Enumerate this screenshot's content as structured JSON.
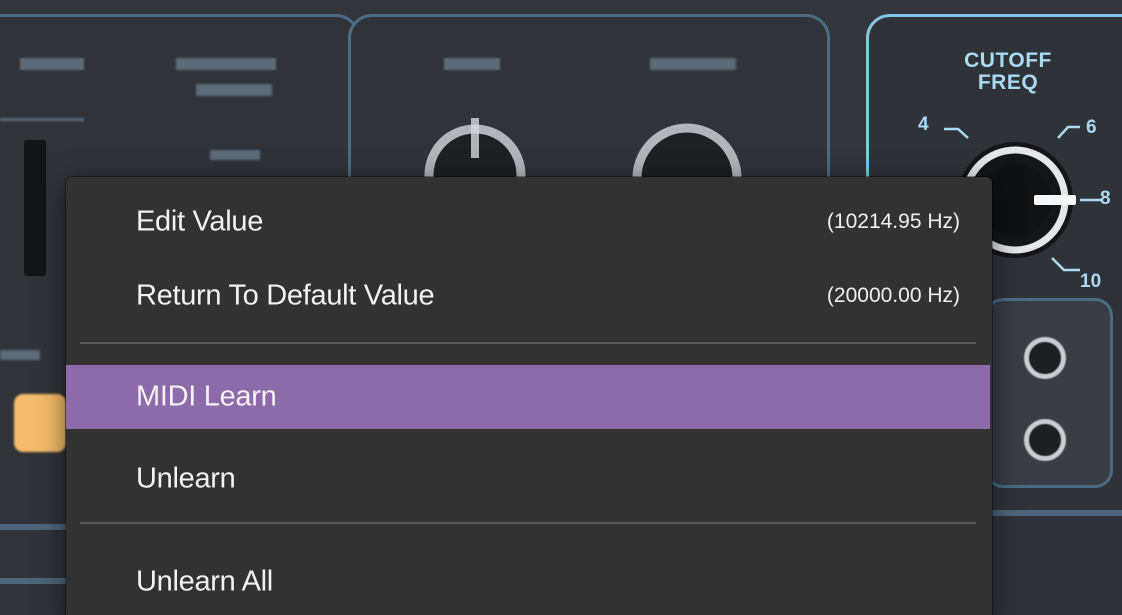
{
  "menu": {
    "items": [
      {
        "label": "Edit Value",
        "value": "(10214.95 Hz)",
        "highlighted": false
      },
      {
        "label": "Return To Default Value",
        "value": "(20000.00 Hz)",
        "highlighted": false
      },
      {
        "label": "MIDI Learn",
        "value": "",
        "highlighted": true
      },
      {
        "label": "Unlearn",
        "value": "",
        "highlighted": false
      },
      {
        "label": "Unlearn All",
        "value": "",
        "highlighted": false
      }
    ],
    "highlight_color": "#8d6aaa"
  },
  "filter": {
    "title_line1": "CUTOFF",
    "title_line2": "FREQ",
    "ticks": [
      "4",
      "6",
      "8",
      "10"
    ],
    "accent_color": "#86c4e6"
  },
  "knobs": {
    "cutoff_freq_value": "10214.95 Hz"
  }
}
